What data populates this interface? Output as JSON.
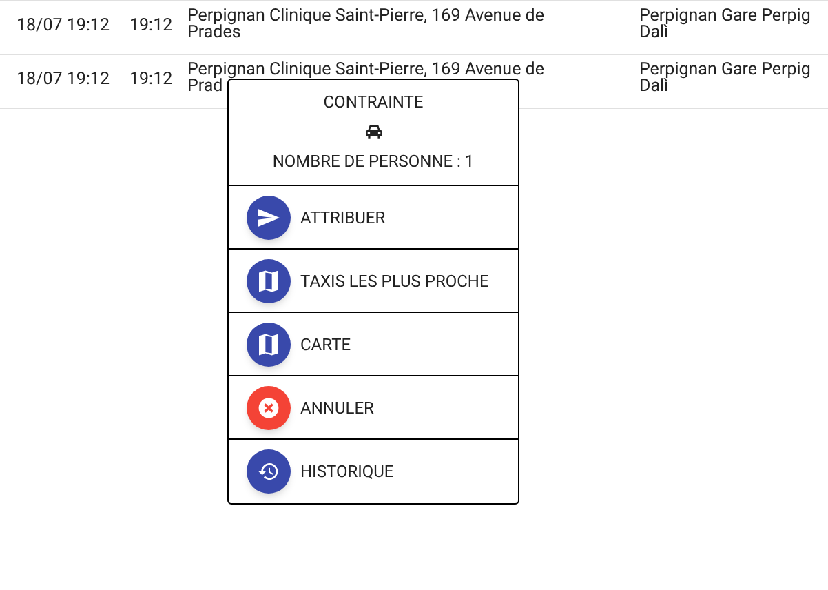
{
  "rows": [
    {
      "date": "18/07 19:12",
      "time": "19:12",
      "pickup": "Perpignan Clinique Saint-Pierre, 169 Avenue de Prades",
      "destination_line_1": "Perpignan Gare Perpig",
      "destination_line_2": "Dalì"
    },
    {
      "date": "18/07 19:12",
      "time": "19:12",
      "pickup_line_1": "Perpignan Clinique Saint-Pierre, 169 Avenue de",
      "pickup_line_2": "Prad",
      "destination_line_1": "Perpignan Gare Perpig",
      "destination_line_2": "Dalì"
    }
  ],
  "menu": {
    "title": "CONTRAINTE",
    "passengers": "NOMBRE DE PERSONNE : 1",
    "items": [
      {
        "kind": "send",
        "label": "ATTRIBUER"
      },
      {
        "kind": "map",
        "label": "TAXIS LES PLUS PROCHE"
      },
      {
        "kind": "map",
        "label": "CARTE"
      },
      {
        "kind": "cancel",
        "label": "ANNULER"
      },
      {
        "kind": "history",
        "label": "HISTORIQUE"
      }
    ]
  }
}
